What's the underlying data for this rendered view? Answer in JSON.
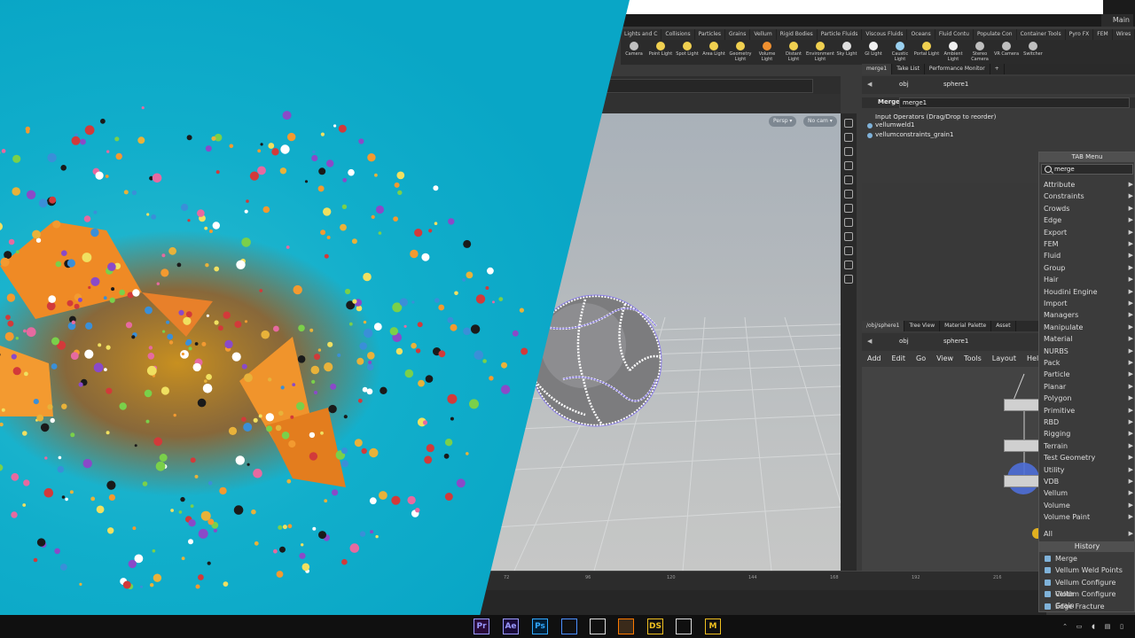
{
  "window": {
    "main_label": "Main"
  },
  "shelf": {
    "tabs": [
      "Lights and C",
      "Collisions",
      "Particles",
      "Grains",
      "Vellum",
      "Rigid Bodies",
      "Particle Fluids",
      "Viscous Fluids",
      "Oceans",
      "Fluid Contu",
      "Populate Con",
      "Container Tools",
      "Pyro FX",
      "FEM",
      "Wires"
    ],
    "tools": [
      {
        "label": "Camera",
        "icon": "camera-icon",
        "color": "#bfbfbf"
      },
      {
        "label": "Point Light",
        "icon": "point-light-icon",
        "color": "#f0d050"
      },
      {
        "label": "Spot Light",
        "icon": "spot-light-icon",
        "color": "#f0d050"
      },
      {
        "label": "Area Light",
        "icon": "area-light-icon",
        "color": "#f0d050"
      },
      {
        "label": "Geometry Light",
        "icon": "geometry-light-icon",
        "color": "#f0d050"
      },
      {
        "label": "Volume Light",
        "icon": "volume-light-icon",
        "color": "#f09030"
      },
      {
        "label": "Distant Light",
        "icon": "distant-light-icon",
        "color": "#f0d050"
      },
      {
        "label": "Environment Light",
        "icon": "environment-light-icon",
        "color": "#f0d050"
      },
      {
        "label": "Sky Light",
        "icon": "sky-light-icon",
        "color": "#e0e0e0"
      },
      {
        "label": "GI Light",
        "icon": "gi-light-icon",
        "color": "#f0f0f0"
      },
      {
        "label": "Caustic Light",
        "icon": "caustic-light-icon",
        "color": "#9ad0ef"
      },
      {
        "label": "Portal Light",
        "icon": "portal-light-icon",
        "color": "#f0d050"
      },
      {
        "label": "Ambient Light",
        "icon": "ambient-light-icon",
        "color": "#f0f0f0"
      },
      {
        "label": "Stereo Camera",
        "icon": "stereo-camera-icon",
        "color": "#bfbfbf"
      },
      {
        "label": "VR Camera",
        "icon": "vr-camera-icon",
        "color": "#bfbfbf"
      },
      {
        "label": "Switcher",
        "icon": "switcher-icon",
        "color": "#bfbfbf"
      }
    ]
  },
  "viewport": {
    "persp": "Persp ▾",
    "cam": "No cam ▾"
  },
  "timeline": {
    "ticks": [
      "72",
      "96",
      "120",
      "144",
      "168",
      "192",
      "216"
    ]
  },
  "params": {
    "tabs": [
      "merge1",
      "Take List",
      "Performance Monitor",
      "+"
    ],
    "path_root": "obj",
    "path_node": "sphere1",
    "node_type": "Merge",
    "node_name": "merge1",
    "input_header": "Input Operators (Drag/Drop to reorder)",
    "inputs": [
      "vellumweld1",
      "vellumconstraints_grain1"
    ]
  },
  "network": {
    "tabs": [
      "/obj/sphere1",
      "Tree View",
      "Material Palette",
      "Asset"
    ],
    "path_root": "obj",
    "path_node": "sphere1",
    "menu": [
      "Add",
      "Edit",
      "Go",
      "View",
      "Tools",
      "Layout",
      "Help"
    ]
  },
  "tab_menu": {
    "title": "TAB Menu",
    "search": "merge",
    "items": [
      "Attribute",
      "Constraints",
      "Crowds",
      "Edge",
      "Export",
      "FEM",
      "Fluid",
      "Group",
      "Hair",
      "Houdini Engine",
      "Import",
      "Managers",
      "Manipulate",
      "Material",
      "NURBS",
      "Pack",
      "Particle",
      "Planar",
      "Polygon",
      "Primitive",
      "RBD",
      "Rigging",
      "Terrain",
      "Test Geometry",
      "Utility",
      "VDB",
      "Vellum",
      "Volume",
      "Volume Paint"
    ],
    "all_label": "All",
    "history_label": "History",
    "history": [
      "Merge",
      "Vellum Weld Points",
      "Vellum Configure Cloth",
      "Vellum Configure Grain",
      "Edge Fracture"
    ]
  },
  "taskbar": {
    "apps": [
      {
        "label": "Pr",
        "color": "#9999ff",
        "bg": "#2a0a3a"
      },
      {
        "label": "Ae",
        "color": "#9999ff",
        "bg": "#1a0a3a"
      },
      {
        "label": "Ps",
        "color": "#31a8ff",
        "bg": "#001e36"
      },
      {
        "label": "",
        "color": "#4a8fff",
        "bg": "#101010"
      },
      {
        "label": "",
        "color": "#dddddd",
        "bg": "#101010"
      },
      {
        "label": "",
        "color": "#ff7a00",
        "bg": "#3a2a1a"
      },
      {
        "label": "DS",
        "color": "#f0c020",
        "bg": "#101010"
      },
      {
        "label": "",
        "color": "#dddddd",
        "bg": "#101010"
      },
      {
        "label": "M",
        "color": "#f0c020",
        "bg": "#101010"
      }
    ]
  }
}
